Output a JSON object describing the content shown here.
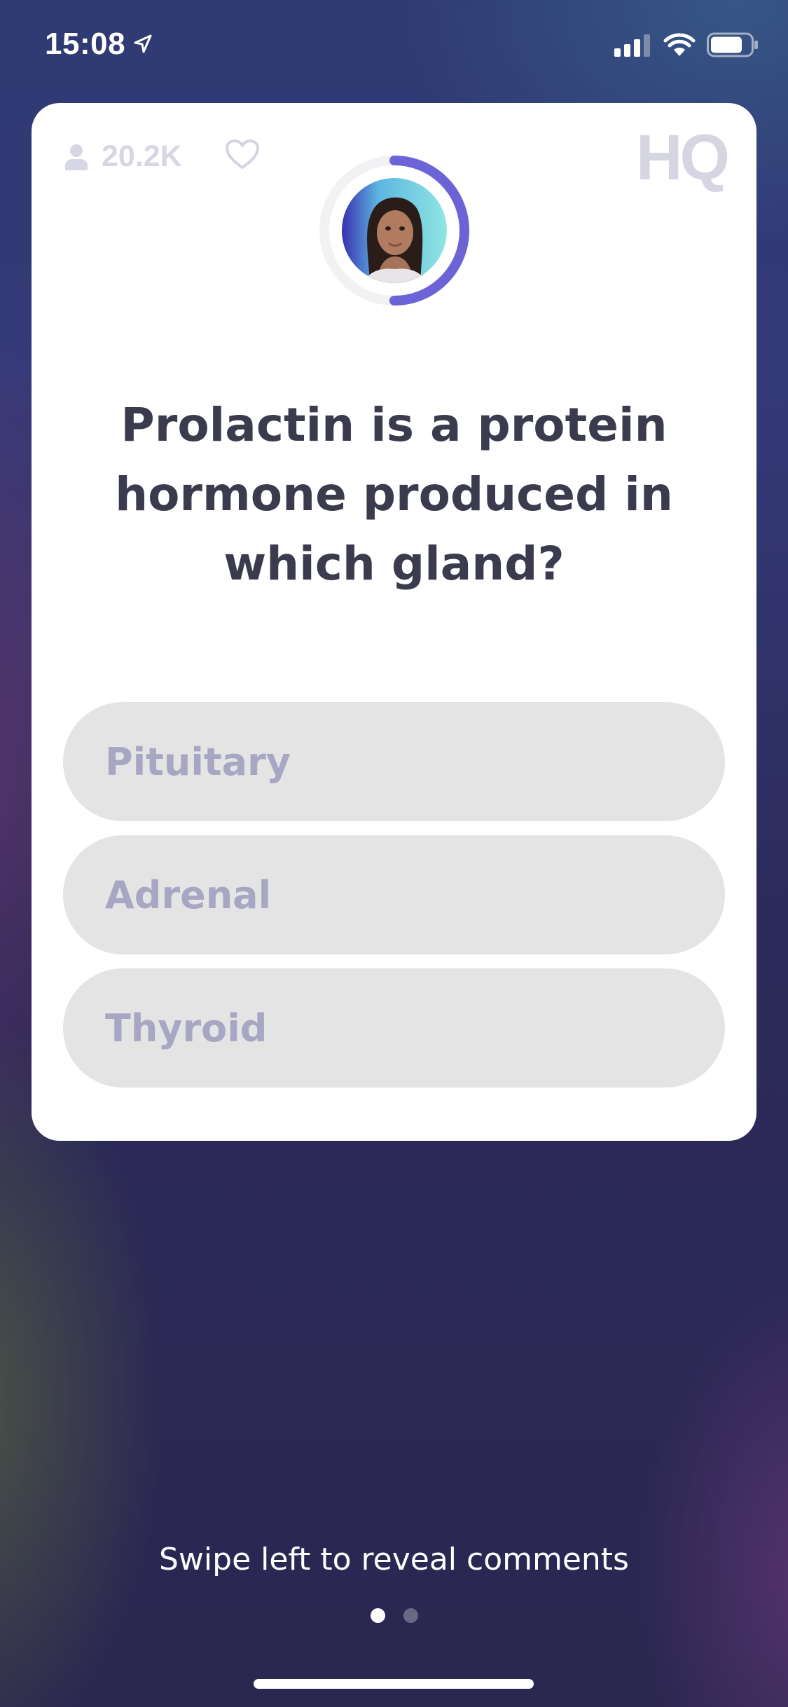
{
  "status_bar": {
    "time": "15:08",
    "icons": [
      "location-arrow-icon",
      "cellular-signal-icon",
      "wifi-icon",
      "battery-icon"
    ]
  },
  "card": {
    "viewer_count": "20.2K",
    "viewer_icon": "person-icon",
    "like_icon": "heart-icon",
    "logo": "HQ",
    "host_avatar_icon": "host-avatar",
    "timer_fraction_remaining": 0.5,
    "timer_color": "#6c63d6",
    "question": "Prolactin is a protein hormone produced in which gland?",
    "answers": [
      {
        "label": "Pituitary"
      },
      {
        "label": "Adrenal"
      },
      {
        "label": "Thyroid"
      }
    ]
  },
  "footer": {
    "swipe_hint": "Swipe left to reveal comments",
    "page_indicator": {
      "current": 1,
      "total": 2
    }
  }
}
